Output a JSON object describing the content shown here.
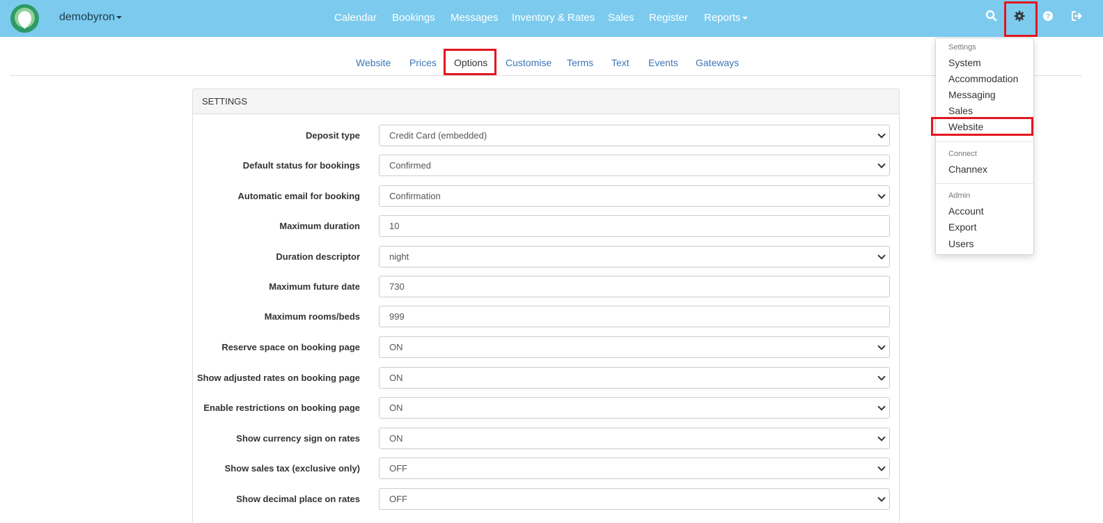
{
  "navbar": {
    "brand": "demobyron",
    "items": [
      "Calendar",
      "Bookings",
      "Messages",
      "Inventory & Rates",
      "Sales",
      "Register",
      "Reports"
    ],
    "icons": [
      "search-icon",
      "gear-icon",
      "help-icon",
      "logout-icon"
    ]
  },
  "subtabs": [
    "Website",
    "Prices",
    "Options",
    "Customise",
    "Terms",
    "Text",
    "Events",
    "Gateways"
  ],
  "active_tab": "Options",
  "panel": {
    "heading": "SETTINGS",
    "rows": [
      {
        "label": "Deposit type",
        "value": "Credit Card (embedded)",
        "kind": "select"
      },
      {
        "label": "Default status for bookings",
        "value": "Confirmed",
        "kind": "select"
      },
      {
        "label": "Automatic email for booking",
        "value": "Confirmation",
        "kind": "select"
      },
      {
        "label": "Maximum duration",
        "value": "10",
        "kind": "input"
      },
      {
        "label": "Duration descriptor",
        "value": "night",
        "kind": "select"
      },
      {
        "label": "Maximum future date",
        "value": "730",
        "kind": "input"
      },
      {
        "label": "Maximum rooms/beds",
        "value": "999",
        "kind": "input"
      },
      {
        "label": "Reserve space on booking page",
        "value": "ON",
        "kind": "select"
      },
      {
        "label": "Show adjusted rates on booking page",
        "value": "ON",
        "kind": "select"
      },
      {
        "label": "Enable restrictions on booking page",
        "value": "ON",
        "kind": "select"
      },
      {
        "label": "Show currency sign on rates",
        "value": "ON",
        "kind": "select"
      },
      {
        "label": "Show sales tax (exclusive only)",
        "value": "OFF",
        "kind": "select"
      },
      {
        "label": "Show decimal place on rates",
        "value": "OFF",
        "kind": "select"
      }
    ]
  },
  "dropdown": {
    "settings_header": "Settings",
    "settings_items": [
      "System",
      "Accommodation",
      "Messaging",
      "Sales",
      "Website"
    ],
    "connect_header": "Connect",
    "connect_items": [
      "Channex"
    ],
    "admin_header": "Admin",
    "admin_items": [
      "Account",
      "Export",
      "Users"
    ]
  },
  "colors": {
    "navbar": "#7ccbee",
    "link": "#3a75b6",
    "highlight": "#e4151f"
  }
}
